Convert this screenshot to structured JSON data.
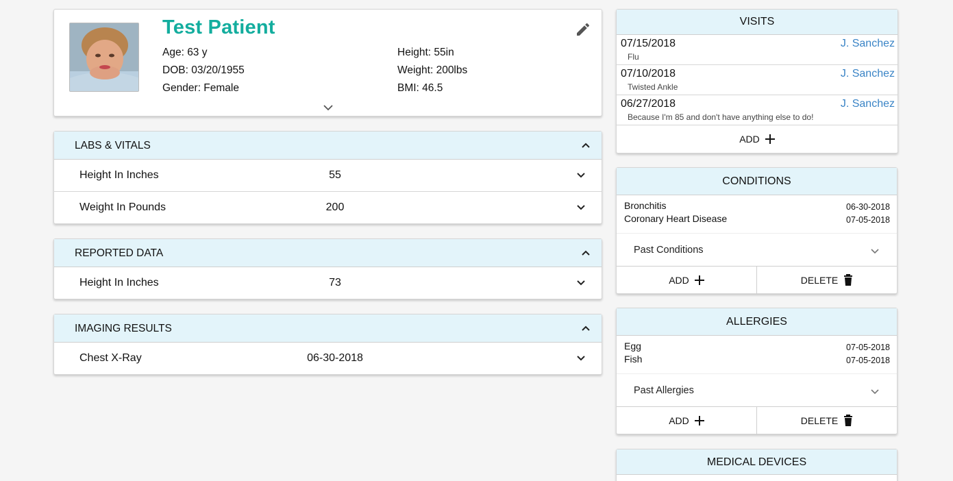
{
  "patient": {
    "name": "Test Patient",
    "age": "Age: 63 y",
    "dob": "DOB: 03/20/1955",
    "gender": "Gender: Female",
    "height": "Height: 55in",
    "weight": "Weight: 200lbs",
    "bmi": "BMI: 46.5",
    "edit_icon": "pencil-icon",
    "expand_icon": "chevron-down-icon"
  },
  "labs_vitals": {
    "title": "LABS & VITALS",
    "rows": [
      {
        "label": "Height In Inches",
        "value": "55"
      },
      {
        "label": "Weight In Pounds",
        "value": "200"
      }
    ]
  },
  "reported_data": {
    "title": "REPORTED DATA",
    "rows": [
      {
        "label": "Height In Inches",
        "value": "73"
      }
    ]
  },
  "imaging_results": {
    "title": "IMAGING RESULTS",
    "rows": [
      {
        "label": "Chest X-Ray",
        "value": "06-30-2018"
      }
    ]
  },
  "visits": {
    "title": "VISITS",
    "items": [
      {
        "date": "07/15/2018",
        "doctor": "J. Sanchez",
        "reason": "Flu"
      },
      {
        "date": "07/10/2018",
        "doctor": "J. Sanchez",
        "reason": "Twisted Ankle"
      },
      {
        "date": "06/27/2018",
        "doctor": "J. Sanchez",
        "reason": "Because I'm 85 and don't have anything else to do!"
      }
    ],
    "add_label": "ADD"
  },
  "conditions": {
    "title": "CONDITIONS",
    "items": [
      {
        "name": "Bronchitis",
        "date": "06-30-2018"
      },
      {
        "name": "Coronary Heart Disease",
        "date": "07-05-2018"
      }
    ],
    "past_label": "Past Conditions",
    "add_label": "ADD",
    "delete_label": "DELETE"
  },
  "allergies": {
    "title": "ALLERGIES",
    "items": [
      {
        "name": "Egg",
        "date": "07-05-2018"
      },
      {
        "name": "Fish",
        "date": "07-05-2018"
      }
    ],
    "past_label": "Past Allergies",
    "add_label": "ADD",
    "delete_label": "DELETE"
  },
  "medical_devices": {
    "title": "MEDICAL DEVICES"
  },
  "colors": {
    "accent_teal": "#13ad9e",
    "link_blue": "#3a84c6",
    "header_bg": "#e3f4fa"
  }
}
